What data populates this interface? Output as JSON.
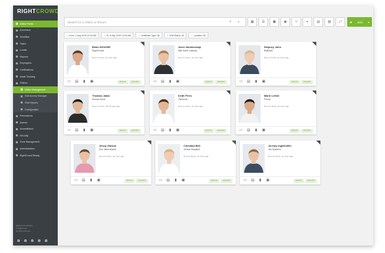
{
  "brand": {
    "part1": "RIGHT",
    "part2": "CROWD"
  },
  "sidebar": {
    "items": [
      {
        "label": "Visitor Portal",
        "active": true,
        "sub": false
      },
      {
        "label": "Enrolment",
        "active": false,
        "sub": false
      },
      {
        "label": "Workflow",
        "active": false,
        "sub": false
      },
      {
        "label": "Tasks",
        "active": false,
        "sub": false
      },
      {
        "label": "Locate",
        "active": false,
        "sub": false
      },
      {
        "label": "Reports",
        "active": false,
        "sub": false
      },
      {
        "label": "Employees",
        "active": false,
        "sub": false
      },
      {
        "label": "Certifications",
        "active": false,
        "sub": false
      },
      {
        "label": "Asset Tracking",
        "active": false,
        "sub": false
      },
      {
        "label": "Visitors",
        "active": false,
        "sub": false
      },
      {
        "label": "Visitor Management",
        "active": true,
        "sub": true
      },
      {
        "label": "Visit Access Manager",
        "active": false,
        "sub": true
      },
      {
        "label": "Visit Reports",
        "active": false,
        "sub": true
      },
      {
        "label": "Configuration",
        "active": false,
        "sub": true
      },
      {
        "label": "Permissions",
        "active": false,
        "sub": false
      },
      {
        "label": "Alarms",
        "active": false,
        "sub": false
      },
      {
        "label": "Accreditation",
        "active": false,
        "sub": false
      },
      {
        "label": "Security",
        "active": false,
        "sub": false
      },
      {
        "label": "Zone Management",
        "active": false,
        "sub": false
      },
      {
        "label": "Administration",
        "active": false,
        "sub": false
      },
      {
        "label": "RightCrowd Ready",
        "active": false,
        "sub": false
      }
    ],
    "footer_lines": [
      "RightCrowd Software",
      "© RightCrowd",
      "All rights reserved"
    ]
  },
  "toolbar": {
    "search_placeholder": "Search for a Visitor or Escort",
    "buttons": [
      "grid-icon",
      "list-icon",
      "calendar-icon",
      "user-icon",
      "filter-icon",
      "pin-icon",
      "layout-icon",
      "image-icon",
      "expand-icon"
    ],
    "green_label": "ADD"
  },
  "filters": [
    "From: 1 Aug 2019 12:00 AM",
    "To: 8 Sep 2019 12:00 AM",
    "Certificate Type: All",
    "Visit Status: All",
    "Location: All"
  ],
  "cards": [
    {
      "name": "Brian HOUSSE",
      "company": "RightCrowd",
      "status": "Due to Arrive, an hour ago",
      "photo": {
        "skin": "#d9a98a",
        "hair": "#5a3c28",
        "shirt": "#ffffff",
        "bg": "#e4e8ec"
      }
    },
    {
      "name": "Jules Vandercamp",
      "company": "Mile North Industry",
      "status": "Due to Arrive, an hour ago",
      "photo": {
        "skin": "#e9c2a6",
        "hair": "#b07c4c",
        "shirt": "#2e3134",
        "bg": "#e6eaee"
      }
    },
    {
      "name": "Stepney John",
      "company": "Ballistoff",
      "status": "Due to Arrive, an hour ago",
      "photo": {
        "skin": "#efcdb4",
        "hair": "#d9b98a",
        "shirt": "#3c4a5e",
        "bg": "#e4e8ec"
      }
    },
    {
      "name": "Thomas Jakra",
      "company": "Kumon Inbox",
      "status": "Due to Arrive, 18 minutes ago",
      "photo": {
        "skin": "#e2b89a",
        "hair": "#1f1a18",
        "shirt": "#2b2b2b",
        "bg": "#e4e8ec"
      }
    },
    {
      "name": "Keith Pires",
      "company": "TierNorth",
      "status": "Due to Arrive, an hour ago",
      "photo": {
        "skin": "#e3b796",
        "hair": "#4b3020",
        "shirt": "#ffffff",
        "bg": "#eceff1"
      }
    },
    {
      "name": "Marie Lethel",
      "company": "Prevot",
      "status": "Due for Entry, an hour ago",
      "photo": {
        "skin": "#d9a98a",
        "hair": "#221a16",
        "shirt": "#f2f2f2",
        "bg": "#e4e8ec"
      }
    },
    {
      "name": "Jenny Gibson",
      "company": "Sun International",
      "status": "Due for Entry, an hour ago",
      "photo": {
        "skin": "#e9c2a6",
        "hair": "#6b4a30",
        "shirt": "#e59ab0",
        "bg": "#e4e8ec"
      }
    },
    {
      "name": "Christina Bell",
      "company": "Ventos Dispatch",
      "status": "Due for Entry, an hour ago",
      "photo": {
        "skin": "#efcdb4",
        "hair": "#d8b47a",
        "shirt": "#ffffff",
        "bg": "#eceff1"
      }
    },
    {
      "name": "Jeremy Inglehoffer",
      "company": "Jax Systems",
      "status": "Due for Entry, an hour ago",
      "photo": {
        "skin": "#e9c2a6",
        "hair": "#8a6a4a",
        "shirt": "#3d4b60",
        "bg": "#e6eaee"
      }
    }
  ],
  "card_actions": {
    "icons": [
      "id-card-icon",
      "print-icon",
      "trash-icon",
      "badge-icon"
    ],
    "pill_left": "SIGN IN",
    "pill_right": "ESCORT"
  }
}
